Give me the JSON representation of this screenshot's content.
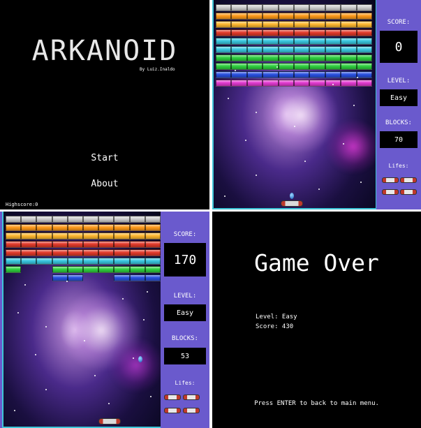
{
  "menu": {
    "title": "ARKANOID",
    "byline": "By Luiz.Inaldo",
    "start_label": "Start",
    "about_label": "About",
    "highscore_label": "Highscore",
    "highscore_value": "0"
  },
  "game1": {
    "score_label": "SCORE:",
    "score_value": "0",
    "level_label": "LEVEL:",
    "level_value": "Easy",
    "blocks_label": "BLOCKS:",
    "blocks_value": "70",
    "lifes_label": "Lifes:",
    "lives": 4
  },
  "game2": {
    "score_label": "SCORE:",
    "score_value": "170",
    "level_label": "LEVEL:",
    "level_value": "Easy",
    "blocks_label": "BLOCKS:",
    "blocks_value": "53",
    "lifes_label": "Lifes:",
    "lives": 4
  },
  "gameover": {
    "title": "Game Over",
    "level_text": "Level: Easy",
    "score_text": "Score: 430",
    "footer": "Press ENTER to back to main menu."
  },
  "brick_colors": [
    "#cfcfcf",
    "#ff9a1a",
    "#ffb830",
    "#e23a2a",
    "#39c7e0",
    "#2fd03f",
    "#2850e0",
    "#e23ad0"
  ]
}
